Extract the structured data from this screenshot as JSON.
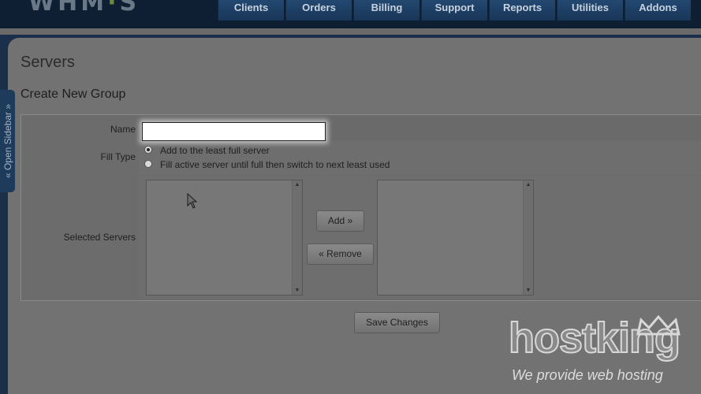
{
  "nav": {
    "tabs": [
      "Clients",
      "Orders",
      "Billing",
      "Support",
      "Reports",
      "Utilities",
      "Addons"
    ]
  },
  "sidebar": {
    "open_label": "« Open Sidebar »"
  },
  "page": {
    "title": "Servers",
    "section_title": "Create New Group"
  },
  "form": {
    "name_label": "Name",
    "name_value": "",
    "fill_type_label": "Fill Type",
    "fill_type_options": [
      "Add to the least full server",
      "Fill active server until full then switch to next least used"
    ],
    "fill_type_selected": 0,
    "selected_servers_label": "Selected Servers",
    "add_button": "Add »",
    "remove_button": "« Remove",
    "save_button": "Save Changes"
  },
  "watermark": {
    "brand": "hostking",
    "tagline": "We provide web hosting"
  },
  "colors": {
    "header": "#0e1f33",
    "nav_tab": "#1f3f66",
    "content_bg": "#727272"
  }
}
